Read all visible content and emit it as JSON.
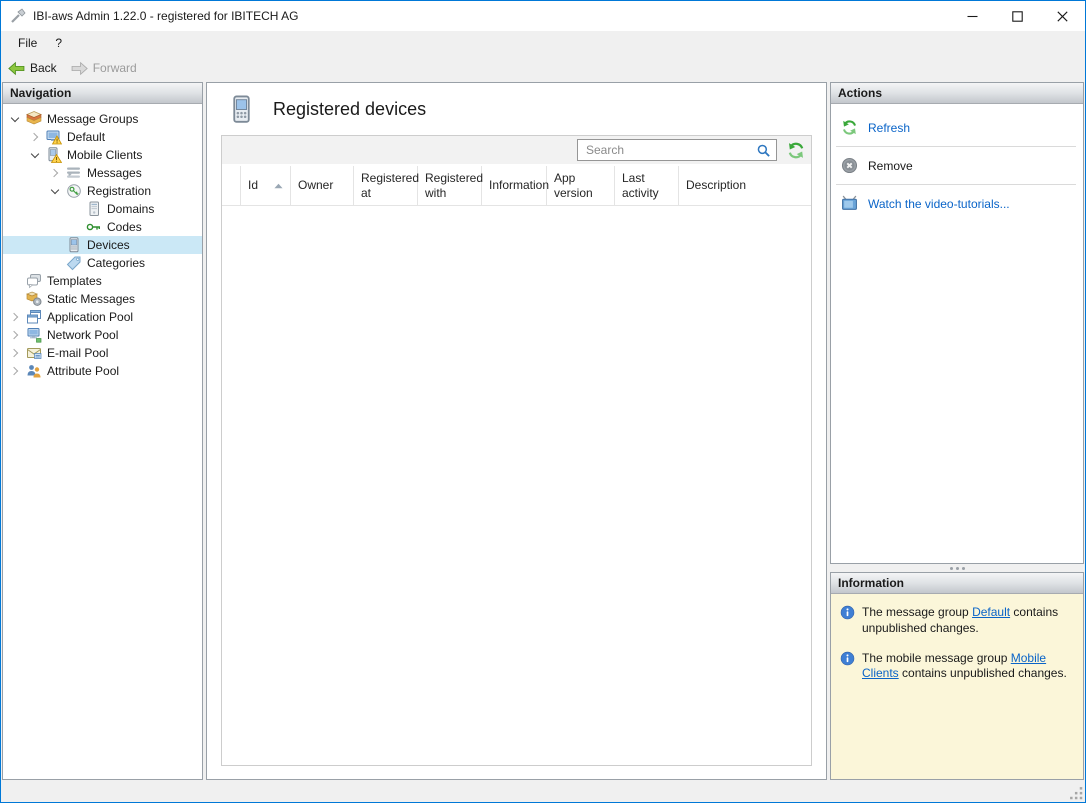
{
  "window": {
    "title": "IBI-aws Admin 1.22.0 - registered for IBITECH AG"
  },
  "menu": {
    "items": [
      {
        "label": "File"
      },
      {
        "label": "?"
      }
    ]
  },
  "toolbar": {
    "back_label": "Back",
    "forward_label": "Forward"
  },
  "navigation": {
    "header": "Navigation",
    "tree": [
      {
        "label": "Message Groups",
        "level": 0,
        "chevron": "expanded",
        "icon": "message-groups-icon",
        "selected": false
      },
      {
        "label": "Default",
        "level": 1,
        "chevron": "collapsed",
        "icon": "default-group-icon",
        "selected": false
      },
      {
        "label": "Mobile Clients",
        "level": 1,
        "chevron": "expanded",
        "icon": "mobile-clients-icon",
        "selected": false
      },
      {
        "label": "Messages",
        "level": 2,
        "chevron": "collapsed",
        "icon": "messages-icon",
        "selected": false
      },
      {
        "label": "Registration",
        "level": 2,
        "chevron": "expanded",
        "icon": "registration-icon",
        "selected": false
      },
      {
        "label": "Domains",
        "level": 3,
        "chevron": "none",
        "icon": "domains-icon",
        "selected": false
      },
      {
        "label": "Codes",
        "level": 3,
        "chevron": "none",
        "icon": "codes-icon",
        "selected": false
      },
      {
        "label": "Devices",
        "level": 2,
        "chevron": "none",
        "icon": "devices-icon",
        "selected": true
      },
      {
        "label": "Categories",
        "level": 2,
        "chevron": "none",
        "icon": "categories-icon",
        "selected": false
      },
      {
        "label": "Templates",
        "level": 0,
        "chevron": "none",
        "icon": "templates-icon",
        "selected": false
      },
      {
        "label": "Static Messages",
        "level": 0,
        "chevron": "none",
        "icon": "static-messages-icon",
        "selected": false
      },
      {
        "label": "Application Pool",
        "level": 0,
        "chevron": "collapsed",
        "icon": "application-pool-icon",
        "selected": false
      },
      {
        "label": "Network Pool",
        "level": 0,
        "chevron": "collapsed",
        "icon": "network-pool-icon",
        "selected": false
      },
      {
        "label": "E-mail Pool",
        "level": 0,
        "chevron": "collapsed",
        "icon": "email-pool-icon",
        "selected": false
      },
      {
        "label": "Attribute Pool",
        "level": 0,
        "chevron": "collapsed",
        "icon": "attribute-pool-icon",
        "selected": false
      }
    ]
  },
  "main": {
    "title": "Registered devices",
    "icon": "registered-devices-icon",
    "search": {
      "placeholder": "Search"
    },
    "table": {
      "columns": [
        {
          "label": ""
        },
        {
          "label": "Id",
          "sort": "asc"
        },
        {
          "label": "Owner"
        },
        {
          "label": "Registered at"
        },
        {
          "label": "Registered with"
        },
        {
          "label": "Information"
        },
        {
          "label": "App version"
        },
        {
          "label": "Last activity"
        },
        {
          "label": "Description"
        }
      ],
      "rows": []
    }
  },
  "actions": {
    "header": "Actions",
    "items": [
      {
        "label": "Refresh",
        "icon": "refresh-icon",
        "style": "link"
      },
      {
        "label": "Remove",
        "icon": "remove-icon",
        "style": "plain"
      },
      {
        "label": "Watch the video-tutorials...",
        "icon": "tv-icon",
        "style": "link"
      }
    ]
  },
  "information": {
    "header": "Information",
    "notes": [
      {
        "prefix": "The message group ",
        "link": "Default",
        "suffix": " contains unpublished changes."
      },
      {
        "prefix": "The mobile message group ",
        "link": "Mobile Clients",
        "suffix": " contains unpublished changes."
      }
    ]
  },
  "colors": {
    "window_border": "#0078d7",
    "tree_selection": "#cbe8f6",
    "link_blue": "#0a64c8",
    "info_panel_bg": "#fbf6d9",
    "refresh_green": "#3aa83a",
    "warning_yellow": "#ffd24d"
  }
}
